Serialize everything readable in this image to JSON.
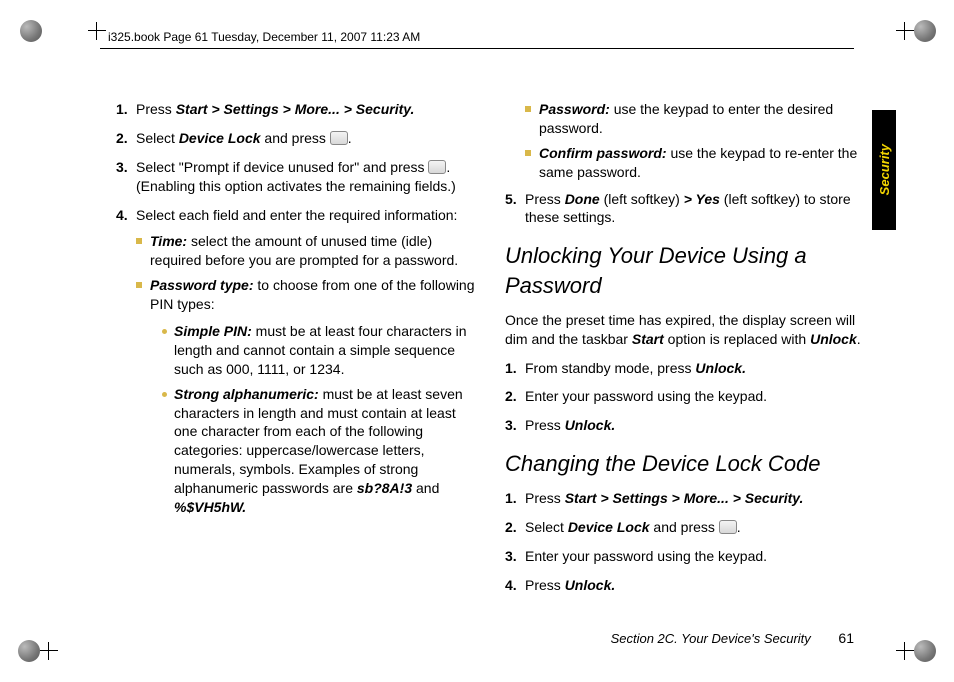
{
  "header": "i325.book  Page 61  Tuesday, December 11, 2007  11:23 AM",
  "sideTab": "Security",
  "footer": {
    "section": "Section 2C. Your Device's Security",
    "page": "61"
  },
  "left": {
    "s1": {
      "n": "1.",
      "a": "Press ",
      "b": "Start > Settings > More... > Security."
    },
    "s2": {
      "n": "2.",
      "a": "Select ",
      "b": "Device Lock",
      "c": " and press ",
      "d": "."
    },
    "s3": {
      "n": "3.",
      "a": "Select \"Prompt if device unused for\" and press ",
      "b": ". (Enabling this option activates the remaining fields.)"
    },
    "s4": {
      "n": "4.",
      "a": "Select each field and enter the required information:"
    },
    "time": {
      "label": "Time:",
      "text": " select the amount of unused time (idle) required before you are prompted for a password."
    },
    "ptype": {
      "label": "Password type:",
      "text": " to choose from one of the following PIN types:"
    },
    "simple": {
      "label": "Simple PIN:",
      "text": " must be at least four characters in length and cannot contain a simple sequence such as 000, 1111, or 1234."
    },
    "strong": {
      "label": "Strong alphanumeric:",
      "text": " must be at least seven characters in length and must contain at least one character from each of the following categories: uppercase/lowercase letters, numerals, symbols. Examples of strong alphanumeric passwords are ",
      "ex1": "sb?8A!3",
      "mid": " and ",
      "ex2": "%$VH5hW."
    }
  },
  "right": {
    "pwd": {
      "label": "Password:",
      "text": " use the keypad to enter the desired password."
    },
    "cpwd": {
      "label": "Confirm password:",
      "text": " use the keypad to re-enter the same password."
    },
    "s5": {
      "n": "5.",
      "a": "Press ",
      "b": "Done",
      "c": " (left softkey) ",
      "d": "> Yes",
      "e": " (left softkey) to store these settings."
    },
    "h1": "Unlocking Your Device Using a Password",
    "p1a": "Once the preset time has expired, the display screen will dim and the taskbar ",
    "p1b": "Start",
    "p1c": " option is replaced with ",
    "p1d": "Unlock",
    "p1e": ".",
    "u1": {
      "n": "1.",
      "a": "From standby mode, press ",
      "b": "Unlock."
    },
    "u2": {
      "n": "2.",
      "a": "Enter your password using the keypad."
    },
    "u3": {
      "n": "3.",
      "a": "Press ",
      "b": "Unlock."
    },
    "h2": "Changing the Device Lock Code",
    "c1": {
      "n": "1.",
      "a": "Press ",
      "b": "Start > Settings > More... > Security."
    },
    "c2": {
      "n": "2.",
      "a": "Select ",
      "b": "Device Lock",
      "c": " and press ",
      "d": "."
    },
    "c3": {
      "n": "3.",
      "a": "Enter your password using the keypad."
    },
    "c4": {
      "n": "4.",
      "a": "Press ",
      "b": "Unlock."
    }
  }
}
